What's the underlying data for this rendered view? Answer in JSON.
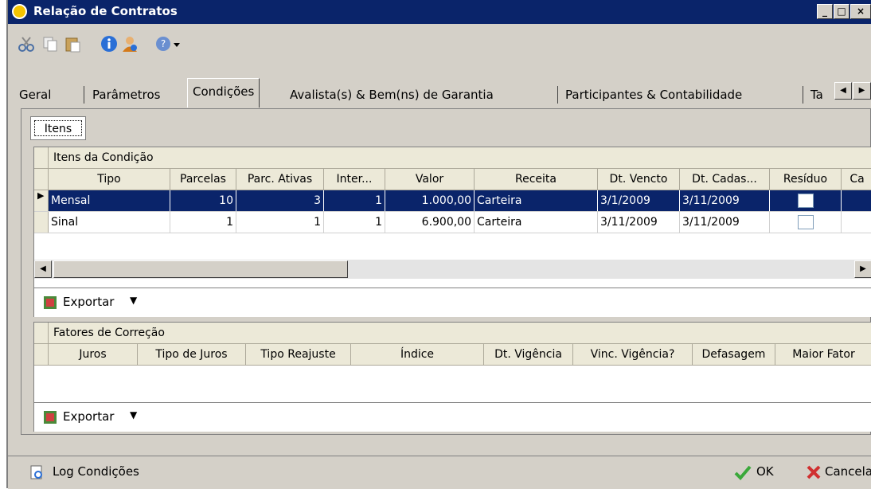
{
  "window": {
    "title": "Relação de Contratos"
  },
  "toolbar": {
    "icons": [
      "cut-icon",
      "copy-icon",
      "paste-icon",
      "info-icon",
      "user-icon",
      "help-icon",
      "dropdown-arrow-icon"
    ]
  },
  "tabs": [
    {
      "label": "Geral"
    },
    {
      "label": "Parâmetros"
    },
    {
      "label": "Condições",
      "active": true
    },
    {
      "label": "Avalista(s) & Bem(ns) de Garantia"
    },
    {
      "label": "Participantes & Contabilidade"
    },
    {
      "label": "Ta"
    }
  ],
  "subtab": {
    "label": "Itens"
  },
  "itens": {
    "group_title": "Itens da Condição",
    "columns": [
      "Tipo",
      "Parcelas",
      "Parc. Ativas",
      "Inter...",
      "Valor",
      "Receita",
      "Dt. Vencto",
      "Dt. Cadas...",
      "Resíduo",
      "Ca"
    ],
    "rows": [
      {
        "tipo": "Mensal",
        "parcelas": "10",
        "parc_ativas": "3",
        "inter": "1",
        "valor": "1.000,00",
        "receita": "Carteira",
        "dt_vencto": "3/1/2009",
        "dt_cadas": "3/11/2009",
        "residuo": false,
        "selected": true
      },
      {
        "tipo": "Sinal",
        "parcelas": "1",
        "parc_ativas": "1",
        "inter": "1",
        "valor": "6.900,00",
        "receita": "Carteira",
        "dt_vencto": "3/11/2009",
        "dt_cadas": "3/11/2009",
        "residuo": false,
        "selected": false
      }
    ],
    "export_label": "Exportar"
  },
  "fatores": {
    "group_title": "Fatores de Correção",
    "columns": [
      "Juros",
      "Tipo de Juros",
      "Tipo Reajuste",
      "Índice",
      "Dt. Vigência",
      "Vinc. Vigência?",
      "Defasagem",
      "Maior Fator"
    ],
    "export_label": "Exportar"
  },
  "footer": {
    "log_label": "Log Condições",
    "ok_label": "OK",
    "cancel_label": "Cancela"
  }
}
